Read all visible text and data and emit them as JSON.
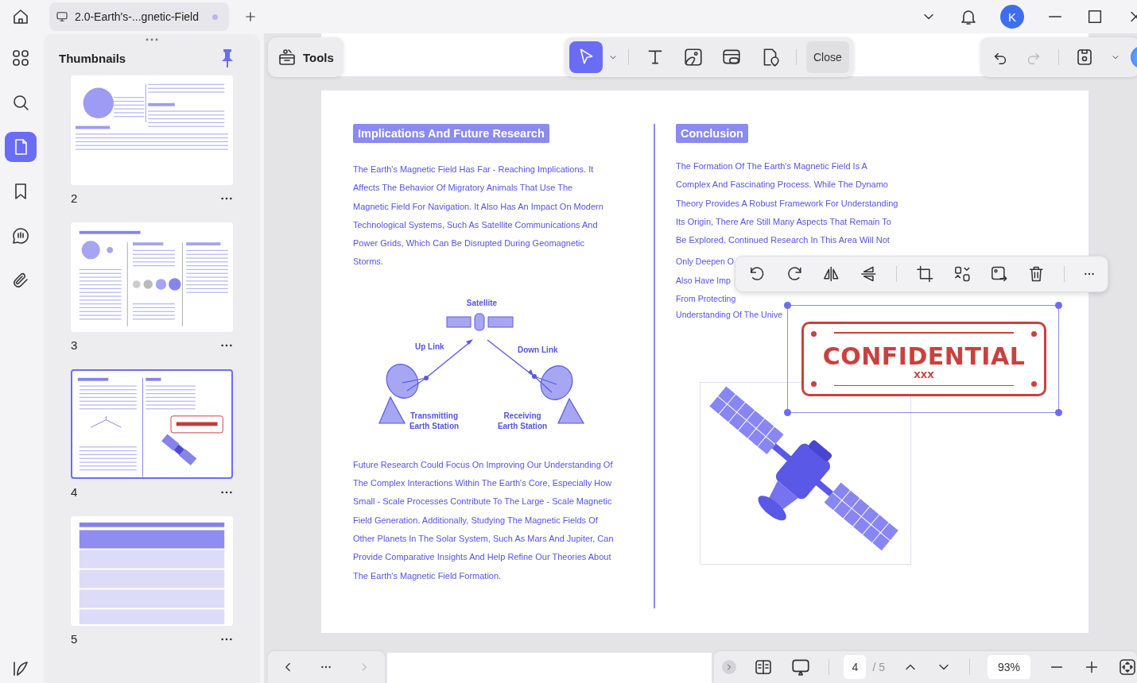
{
  "tab": {
    "title": "2.0-Earth's-...gnetic-Field",
    "unsaved": true
  },
  "user": {
    "initial": "K"
  },
  "rail": [
    {
      "kind": "grid",
      "selected": false
    },
    {
      "kind": "search",
      "selected": false
    },
    {
      "kind": "pages",
      "selected": true
    },
    {
      "kind": "bookmark",
      "selected": false
    },
    {
      "kind": "comment",
      "selected": false
    },
    {
      "kind": "attachment",
      "selected": false
    }
  ],
  "thumbnails": {
    "title": "Thumbnails",
    "pinned": true,
    "pages": [
      {
        "label": "2",
        "selected": false,
        "kind": "globe"
      },
      {
        "label": "3",
        "selected": false,
        "kind": "theories"
      },
      {
        "label": "4",
        "selected": true,
        "kind": "satellite"
      },
      {
        "label": "5",
        "selected": false,
        "kind": "table"
      }
    ]
  },
  "toolbar": {
    "tools_label": "Tools",
    "tools": [
      {
        "kind": "select",
        "selected": true
      },
      {
        "kind": "text",
        "selected": false
      },
      {
        "kind": "image",
        "selected": false
      },
      {
        "kind": "link",
        "selected": false
      },
      {
        "kind": "location",
        "selected": false
      }
    ],
    "close": "Close"
  },
  "document": {
    "left_heading": "Implications And Future Research",
    "left_para1": [
      "The Earth's Magnetic Field Has Far - Reaching Implications. It",
      "Affects The Behavior Of Migratory Animals That Use The",
      "Magnetic Field For Navigation. It Also Has An Impact On Modern",
      "Technological Systems, Such As Satellite Communications And",
      "Power Grids, Which Can Be Disrupted During Geomagnetic",
      "Storms."
    ],
    "diagram": {
      "satellite": "Satellite",
      "uplink": "Up Link",
      "downlink": "Down Link",
      "transmit": [
        "Transmitting",
        "Earth Station"
      ],
      "receive": [
        "Receiving",
        "Earth Station"
      ]
    },
    "left_para2": [
      "Future Research Could Focus On Improving Our Understanding Of",
      "The Complex Interactions Within The Earth's Core, Especially How",
      "Small - Scale Processes Contribute To The Large - Scale Magnetic",
      "Field Generation. Additionally, Studying The Magnetic Fields Of",
      "Other Planets In The Solar System, Such As Mars And Jupiter, Can",
      "Provide Comparative Insights And Help Refine Our Theories About",
      "The Earth's Magnetic Field Formation."
    ],
    "right_heading": "Conclusion",
    "right_para": [
      "The Formation Of The Earth's Magnetic Field Is A",
      "Complex And Fascinating Process. While The Dynamo",
      "Theory Provides A Robust Framework For Understanding",
      "Its Origin, There Are Still Many Aspects That Remain To",
      "Be Explored. Continued Research In This Area Will Not"
    ],
    "right_para_covered": [
      "Only Deepen O",
      "Also Have Imp",
      "From Protecting",
      "Understanding Of The Unive"
    ],
    "stamp": {
      "title": "CONFIDENTIAL",
      "subtitle": "XXX"
    }
  },
  "footer": {
    "page": "4",
    "total": "/ 5",
    "zoom": "93%"
  }
}
